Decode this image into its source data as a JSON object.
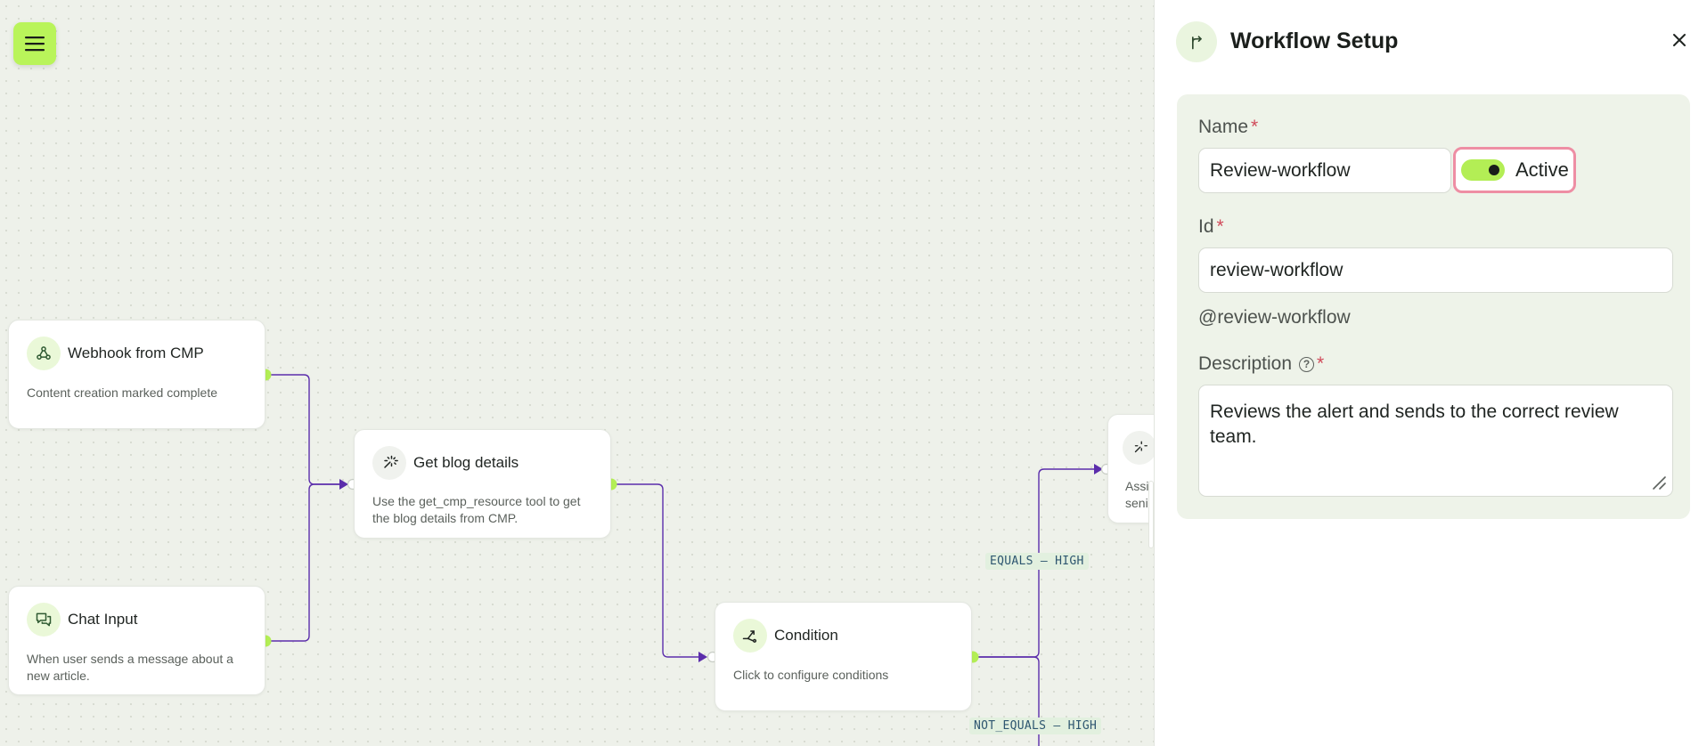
{
  "canvas": {
    "nodes": {
      "webhook": {
        "title": "Webhook from CMP",
        "desc": "Content creation marked complete",
        "icon": "webhook-icon"
      },
      "chat": {
        "title": "Chat Input",
        "desc": "When user sends a message about a new article.",
        "icon": "chat-icon"
      },
      "blog": {
        "title": "Get blog details",
        "desc": "Use the get_cmp_resource tool to get the blog details from CMP.",
        "icon": "sparkle-icon"
      },
      "condition": {
        "title": "Condition",
        "desc": "Click to configure conditions",
        "icon": "branch-icon"
      },
      "partial": {
        "desc_line1": "Assi",
        "desc_line2": "seni",
        "icon": "sparkle-icon"
      }
    },
    "edges": {
      "equals_label": "EQUALS – HIGH",
      "not_equals_label": "NOT_EQUALS – HIGH"
    },
    "colors": {
      "accent": "#b3ee55",
      "wire": "#5b2dab"
    }
  },
  "panel": {
    "title": "Workflow Setup",
    "name_label": "Name",
    "name_value": "Review-workflow",
    "required_mark": "*",
    "toggle_label": "Active",
    "toggle_on": true,
    "id_label": "Id",
    "id_value": "review-workflow",
    "handle": "@review-workflow",
    "description_label": "Description",
    "help_glyph": "?",
    "description_value": "Reviews the alert and sends to the correct review team."
  }
}
